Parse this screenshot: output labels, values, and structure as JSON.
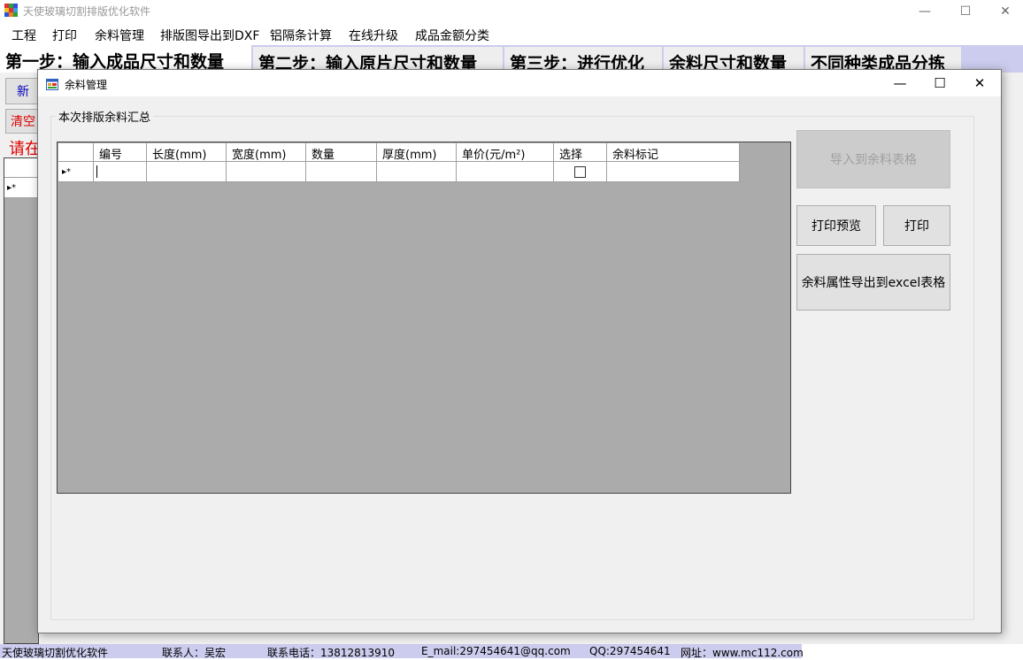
{
  "app": {
    "title": "天使玻璃切割排版优化软件",
    "minimize_glyph": "—",
    "maximize_glyph": "☐",
    "close_glyph": "✕"
  },
  "menu": [
    "工程",
    "打印",
    "余料管理",
    "排版图导出到DXF",
    "铝隔条计算",
    "在线升级",
    "成品金额分类"
  ],
  "tabs": [
    "第一步：输入成品尺寸和数量",
    "第二步：输入原片尺寸和数量",
    "第三步：进行优化",
    "余料尺寸和数量",
    "不同种类成品分拣"
  ],
  "background": {
    "button1_partial": "新",
    "button2_partial": "清空",
    "hint_partial": "请在",
    "row_marker": "▸*"
  },
  "dialog": {
    "title": "余料管理",
    "group_title": "本次排版余料汇总",
    "columns": [
      "编号",
      "长度(mm)",
      "宽度(mm)",
      "数量",
      "厚度(mm)",
      "单价(元/m²)",
      "选择",
      "余料标记"
    ],
    "new_row_marker": "▸*",
    "new_row_select_checked": false,
    "buttons": {
      "import": "导入到余料表格",
      "print_preview": "打印预览",
      "print": "打印",
      "export_excel": "余料属性导出到excel表格"
    }
  },
  "status": {
    "app": "天使玻璃切割优化软件",
    "contact": "联系人：吴宏",
    "phone": "联系电话：13812813910",
    "email": "E_mail:297454641@qq.com",
    "qq": "QQ:297454641",
    "website": "网址：www.mc112.com"
  }
}
